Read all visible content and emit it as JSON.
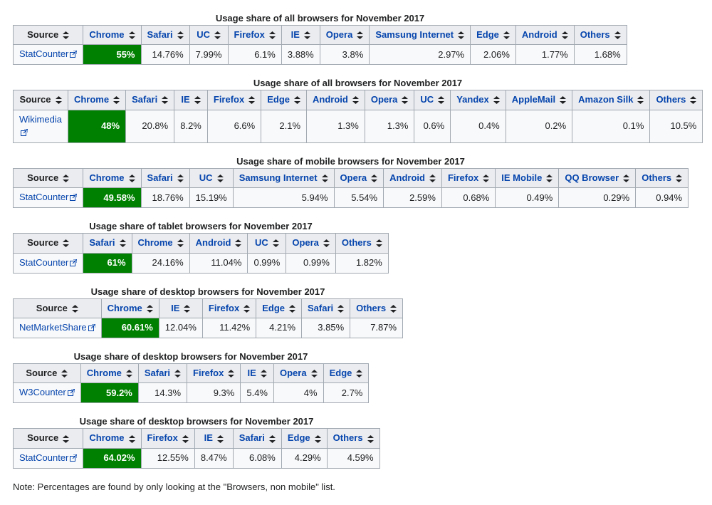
{
  "sort_icon": "sort-icon",
  "ext_icon": "external-link-icon",
  "note": "Note: Percentages are found by only looking at the \"Browsers, non mobile\" list.",
  "tables": [
    {
      "caption": "Usage share of all browsers for November 2017",
      "source": "StatCounter",
      "cols": [
        "Chrome",
        "Safari",
        "UC",
        "Firefox",
        "IE",
        "Opera",
        "Samsung Internet",
        "Edge",
        "Android",
        "Others"
      ],
      "vals": [
        "55%",
        "14.76%",
        "7.99%",
        "6.1%",
        "3.88%",
        "3.8%",
        "2.97%",
        "2.06%",
        "1.77%",
        "1.68%"
      ]
    },
    {
      "caption": "Usage share of all browsers for November 2017",
      "source": "Wikimedia",
      "cols": [
        "Chrome",
        "Safari",
        "IE",
        "Firefox",
        "Edge",
        "Android",
        "Opera",
        "UC",
        "Yandex",
        "AppleMail",
        "Amazon Silk",
        "Others"
      ],
      "vals": [
        "48%",
        "20.8%",
        "8.2%",
        "6.6%",
        "2.1%",
        "1.3%",
        "1.3%",
        "0.6%",
        "0.4%",
        "0.2%",
        "0.1%",
        "10.5%"
      ]
    },
    {
      "caption": "Usage share of mobile browsers for November 2017",
      "source": "StatCounter",
      "cols": [
        "Chrome",
        "Safari",
        "UC",
        "Samsung Internet",
        "Opera",
        "Android",
        "Firefox",
        "IE Mobile",
        "QQ Browser",
        "Others"
      ],
      "vals": [
        "49.58%",
        "18.76%",
        "15.19%",
        "5.94%",
        "5.54%",
        "2.59%",
        "0.68%",
        "0.49%",
        "0.29%",
        "0.94%"
      ]
    },
    {
      "caption": "Usage share of tablet browsers for November 2017",
      "source": "StatCounter",
      "cols": [
        "Safari",
        "Chrome",
        "Android",
        "UC",
        "Opera",
        "Others"
      ],
      "vals": [
        "61%",
        "24.16%",
        "11.04%",
        "0.99%",
        "0.99%",
        "1.82%"
      ]
    },
    {
      "caption": "Usage share of desktop browsers for November 2017",
      "source": "NetMarketShare",
      "cols": [
        "Chrome",
        "IE",
        "Firefox",
        "Edge",
        "Safari",
        "Others"
      ],
      "vals": [
        "60.61%",
        "12.04%",
        "11.42%",
        "4.21%",
        "3.85%",
        "7.87%"
      ]
    },
    {
      "caption": "Usage share of desktop browsers for November 2017",
      "source": "W3Counter",
      "cols": [
        "Chrome",
        "Safari",
        "Firefox",
        "IE",
        "Opera",
        "Edge"
      ],
      "vals": [
        "59.2%",
        "14.3%",
        "9.3%",
        "5.4%",
        "4%",
        "2.7%"
      ]
    },
    {
      "caption": "Usage share of desktop browsers for November 2017",
      "source": "StatCounter",
      "cols": [
        "Chrome",
        "Firefox",
        "IE",
        "Safari",
        "Edge",
        "Others"
      ],
      "vals": [
        "64.02%",
        "12.55%",
        "8.47%",
        "6.08%",
        "4.29%",
        "4.59%"
      ]
    }
  ]
}
